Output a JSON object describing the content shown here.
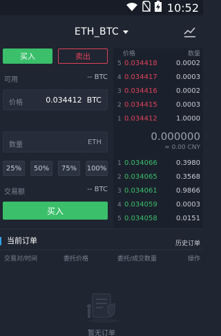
{
  "status_bar": {
    "time": "10:52"
  },
  "header": {
    "pair": "ETH_BTC"
  },
  "trade": {
    "buy_tab": "买入",
    "sell_tab": "卖出",
    "available_label": "可用",
    "available_value": "-- BTC",
    "price_label": "价格",
    "price_value": "0.034412",
    "price_unit": "BTC",
    "qty_placeholder": "数量",
    "qty_unit": "ETH",
    "percents": [
      "25%",
      "50%",
      "75%",
      "100%"
    ],
    "amount_label": "交易额",
    "amount_value": "-- BTC",
    "action_button": "买入"
  },
  "order_book": {
    "header_price": "价格",
    "header_qty": "数量",
    "asks": [
      {
        "idx": "5",
        "price": "0.034418",
        "qty": "0.0002"
      },
      {
        "idx": "4",
        "price": "0.034417",
        "qty": "0.0003"
      },
      {
        "idx": "3",
        "price": "0.034416",
        "qty": "0.0002"
      },
      {
        "idx": "2",
        "price": "0.034415",
        "qty": "0.0003"
      },
      {
        "idx": "1",
        "price": "0.034412",
        "qty": "1.0000"
      }
    ],
    "last_price": "0.000000",
    "last_cny": "≈ 0.00 CNY",
    "bids": [
      {
        "idx": "1",
        "price": "0.034066",
        "qty": "0.3980"
      },
      {
        "idx": "2",
        "price": "0.034065",
        "qty": "0.3568"
      },
      {
        "idx": "3",
        "price": "0.034061",
        "qty": "0.9866"
      },
      {
        "idx": "4",
        "price": "0.034059",
        "qty": "0.0003"
      },
      {
        "idx": "5",
        "price": "0.034058",
        "qty": "0.0151"
      }
    ]
  },
  "orders": {
    "title": "当前订单",
    "history": "历史订单",
    "columns": [
      "交易对/时间",
      "委托价格",
      "委托/成交数量",
      "操作"
    ],
    "empty_text": "暂无订单"
  },
  "colors": {
    "buy": "#3bbf6b",
    "sell": "#e0425a",
    "accent": "#2ea3e6",
    "background": "#1f2531"
  }
}
